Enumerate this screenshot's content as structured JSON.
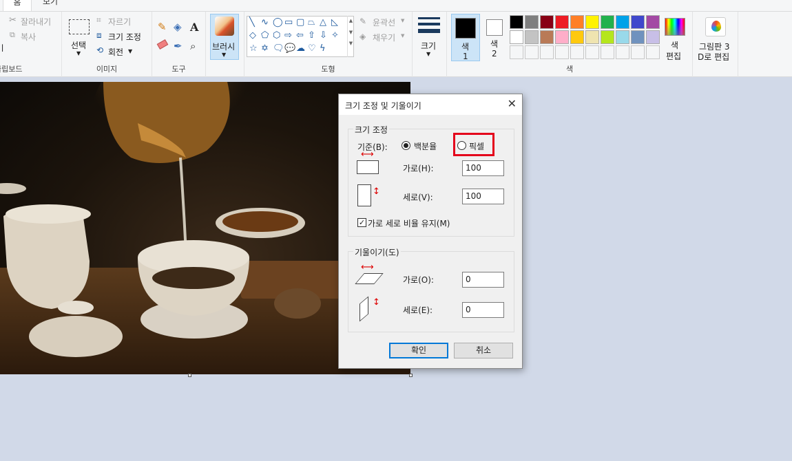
{
  "tabs": {
    "home_partial": "홈",
    "view": "보기"
  },
  "clipboard": {
    "cut": "잘라내기",
    "copy": "복사",
    "group": "클립보드"
  },
  "image": {
    "select": "선택",
    "crop": "자르기",
    "resize": "크기 조정",
    "rotate": "회전",
    "group": "이미지"
  },
  "tools": {
    "group": "도구"
  },
  "brush": {
    "label": "브러시"
  },
  "shapes": {
    "outline": "윤곽선",
    "fill": "채우기",
    "group": "도형"
  },
  "size": {
    "label": "크기"
  },
  "colors": {
    "color1": "색\n1",
    "color1_a": "색",
    "color1_b": "1",
    "color2_a": "색",
    "color2_b": "2",
    "edit_a": "색",
    "edit_b": "편집",
    "group": "색",
    "palette_row1": [
      "#000000",
      "#7f7f7f",
      "#880015",
      "#ed1c24",
      "#ff7f27",
      "#fff200",
      "#22b14c",
      "#00a2e8",
      "#3f48cc",
      "#a349a4"
    ],
    "palette_row2": [
      "#ffffff",
      "#c3c3c3",
      "#b97a57",
      "#ffaec9",
      "#ffc90e",
      "#efe4b0",
      "#b5e61d",
      "#99d9ea",
      "#7092be",
      "#c8bfe7"
    ]
  },
  "paint3d": {
    "line1": "그림판 3",
    "line2": "D로 편집"
  },
  "dialog": {
    "title": "크기 조정 및 기울이기",
    "resize_section": "크기 조정",
    "basis_label": "기준(B):",
    "percent_option": "백분율",
    "pixel_option": "픽셀",
    "horizontal_label": "가로(H):",
    "horizontal_value": "100",
    "vertical_label": "세로(V):",
    "vertical_value": "100",
    "keep_ratio_label": "가로 세로 비율 유지(M)",
    "skew_section": "기울이기(도)",
    "skew_h_label": "가로(O):",
    "skew_h_value": "0",
    "skew_v_label": "세로(E):",
    "skew_v_value": "0",
    "ok": "확인",
    "cancel": "취소"
  }
}
